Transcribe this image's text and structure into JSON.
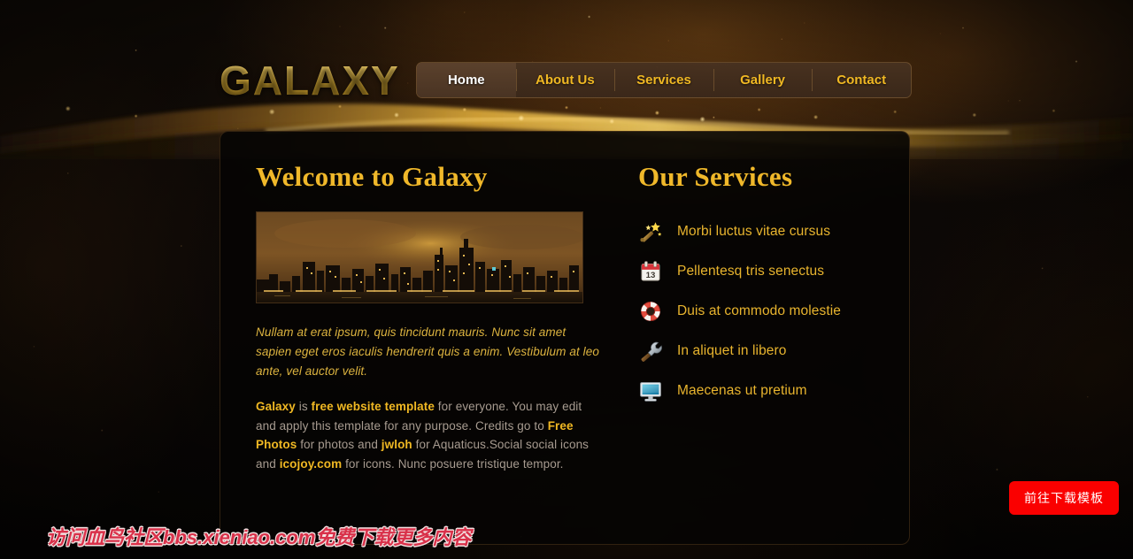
{
  "site": {
    "logo": "GALAXY"
  },
  "nav": {
    "items": [
      {
        "label": "Home",
        "active": true
      },
      {
        "label": "About Us",
        "active": false
      },
      {
        "label": "Services",
        "active": false
      },
      {
        "label": "Gallery",
        "active": false
      },
      {
        "label": "Contact",
        "active": false
      }
    ]
  },
  "welcome": {
    "title": "Welcome to Galaxy",
    "photo_alt": "city-skyline-at-night",
    "intro_italic": "Nullam at erat ipsum, quis tincidunt mauris. Nunc sit amet sapien eget eros iaculis hendrerit quis a enim. Vestibulum at leo ante, vel auctor velit.",
    "credits": {
      "link_galaxy": "Galaxy",
      "text_1": " is ",
      "link_template": "free website template",
      "text_2": " for everyone. You may edit and apply this template for any purpose. Credits go to ",
      "link_freephotos": "Free Photos",
      "text_3": " for photos and ",
      "link_jwloh": "jwloh",
      "text_4": " for Aquaticus.Social social icons and ",
      "link_icojoy": "icojoy.com",
      "text_5": " for icons. Nunc posuere tristique tempor."
    }
  },
  "services": {
    "title": "Our Services",
    "items": [
      {
        "label": "Morbi luctus vitae cursus",
        "icon": "magic-wand-icon"
      },
      {
        "label": "Pellentesq tris senectus",
        "icon": "calendar-icon"
      },
      {
        "label": "Duis at commodo molestie",
        "icon": "lifebuoy-icon"
      },
      {
        "label": "In aliquet in libero",
        "icon": "wrench-icon"
      },
      {
        "label": "Maecenas ut pretium",
        "icon": "monitor-icon"
      }
    ]
  },
  "overlay": {
    "watermark": "访问血鸟社区bbs.xieniao.com免费下载更多内容",
    "download_button": "前往下载模板"
  },
  "colors": {
    "gold": "#f0b823",
    "gold_heading": "#f0b82a",
    "body_text": "#a79b90",
    "italic_text": "#dcb33f",
    "nav_bg": "#483221",
    "panel_bg": "#060403",
    "page_bg": "#080604",
    "button_red": "#fa0000",
    "watermark_red": "#d9314a"
  }
}
